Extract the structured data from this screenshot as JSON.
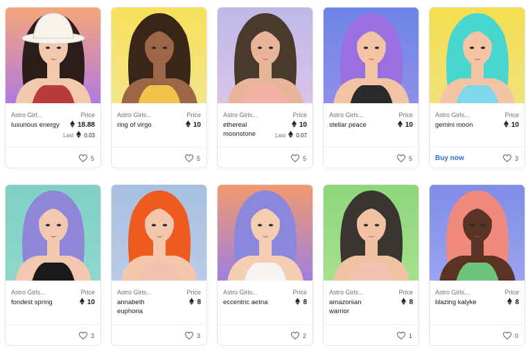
{
  "cards": [
    {
      "collection": "Astro Girl...",
      "price_label": "Price",
      "name": "luxurious energy",
      "price": "18.88",
      "eth_icon": "ethereum-icon",
      "last_label": "Last",
      "last_value": "0.03",
      "likes": "5",
      "art": {
        "bg1": "#f6a57b",
        "bg2": "#b07adf",
        "hair": "#2a1d1a",
        "skin": "#f3c9ae",
        "outfit": "#b93a3a",
        "hat": "#f7f3ea"
      }
    },
    {
      "collection": "Astro Girls...",
      "price_label": "Price",
      "name": "ring of virgo",
      "price": "10",
      "eth_icon": "ethereum-icon",
      "likes": "5",
      "art": {
        "bg1": "#f7e15a",
        "bg2": "#f3e48a",
        "hair": "#3a2618",
        "skin": "#9c6647",
        "outfit": "#f2c24a"
      }
    },
    {
      "collection": "Astro Girls...",
      "price_label": "Price",
      "name": "ethereal moonstone",
      "price": "10",
      "eth_icon": "ethereum-icon",
      "last_label": "Last",
      "last_value": "0.07",
      "likes": "5",
      "art": {
        "bg1": "#bfb8e6",
        "bg2": "#d9c4ea",
        "hair": "#4a3a2c",
        "skin": "#e9b59a",
        "outfit": "#f1b1a3"
      }
    },
    {
      "collection": "Astro Girls...",
      "price_label": "Price",
      "name": "stellar peace",
      "price": "10",
      "eth_icon": "ethereum-icon",
      "likes": "5",
      "art": {
        "bg1": "#6c85e6",
        "bg2": "#8f8fe9",
        "hair": "#9b6fe0",
        "skin": "#f2c3a4",
        "outfit": "#2a2a2a"
      }
    },
    {
      "collection": "Astro Girls...",
      "price_label": "Price",
      "name": "gemini moon",
      "price": "10",
      "eth_icon": "ethereum-icon",
      "buy_label": "Buy now",
      "likes": "3",
      "art": {
        "bg1": "#f4dd4f",
        "bg2": "#f0e27a",
        "hair": "#49d6cf",
        "skin": "#f3c5a6",
        "outfit": "#7fd7ea"
      }
    },
    {
      "collection": "Astro Girls...",
      "price_label": "Price",
      "name": "fondest spring",
      "price": "10",
      "eth_icon": "ethereum-icon",
      "likes": "3",
      "art": {
        "bg1": "#7fd1c4",
        "bg2": "#8fd7cd",
        "hair": "#8f86d8",
        "skin": "#f2c9b0",
        "outfit": "#1b1b1b"
      }
    },
    {
      "collection": "Astro Girls...",
      "price_label": "Price",
      "name": "annabeth euphoria",
      "price": "8",
      "eth_icon": "ethereum-icon",
      "likes": "3",
      "art": {
        "bg1": "#a7c0e0",
        "bg2": "#b9cbe6",
        "hair": "#ee5a1f",
        "skin": "#f4c7ab",
        "outfit": "#f1c2b0"
      }
    },
    {
      "collection": "Astro Girls...",
      "price_label": "Price",
      "name": "eccentric aetna",
      "price": "8",
      "eth_icon": "ethereum-icon",
      "likes": "2",
      "art": {
        "bg1": "#f09a6e",
        "bg2": "#a07fe0",
        "hair": "#8a87dc",
        "skin": "#f4cdb3",
        "outfit": "#f7f3f0"
      }
    },
    {
      "collection": "Astro Girls...",
      "price_label": "Price",
      "name": "amazonian warrior",
      "price": "8",
      "eth_icon": "ethereum-icon",
      "likes": "1",
      "art": {
        "bg1": "#8ed67c",
        "bg2": "#a6e08e",
        "hair": "#3b3531",
        "skin": "#f0c1a3",
        "outfit": "#f2c3b2"
      }
    },
    {
      "collection": "Astro Girls...",
      "price_label": "Price",
      "name": "blazing kalyke",
      "price": "8",
      "eth_icon": "ethereum-icon",
      "likes": "0",
      "art": {
        "bg1": "#7f8de8",
        "bg2": "#9aa3ef",
        "hair": "#f08a7c",
        "skin": "#5a3324",
        "outfit": "#6dc47a"
      }
    }
  ]
}
